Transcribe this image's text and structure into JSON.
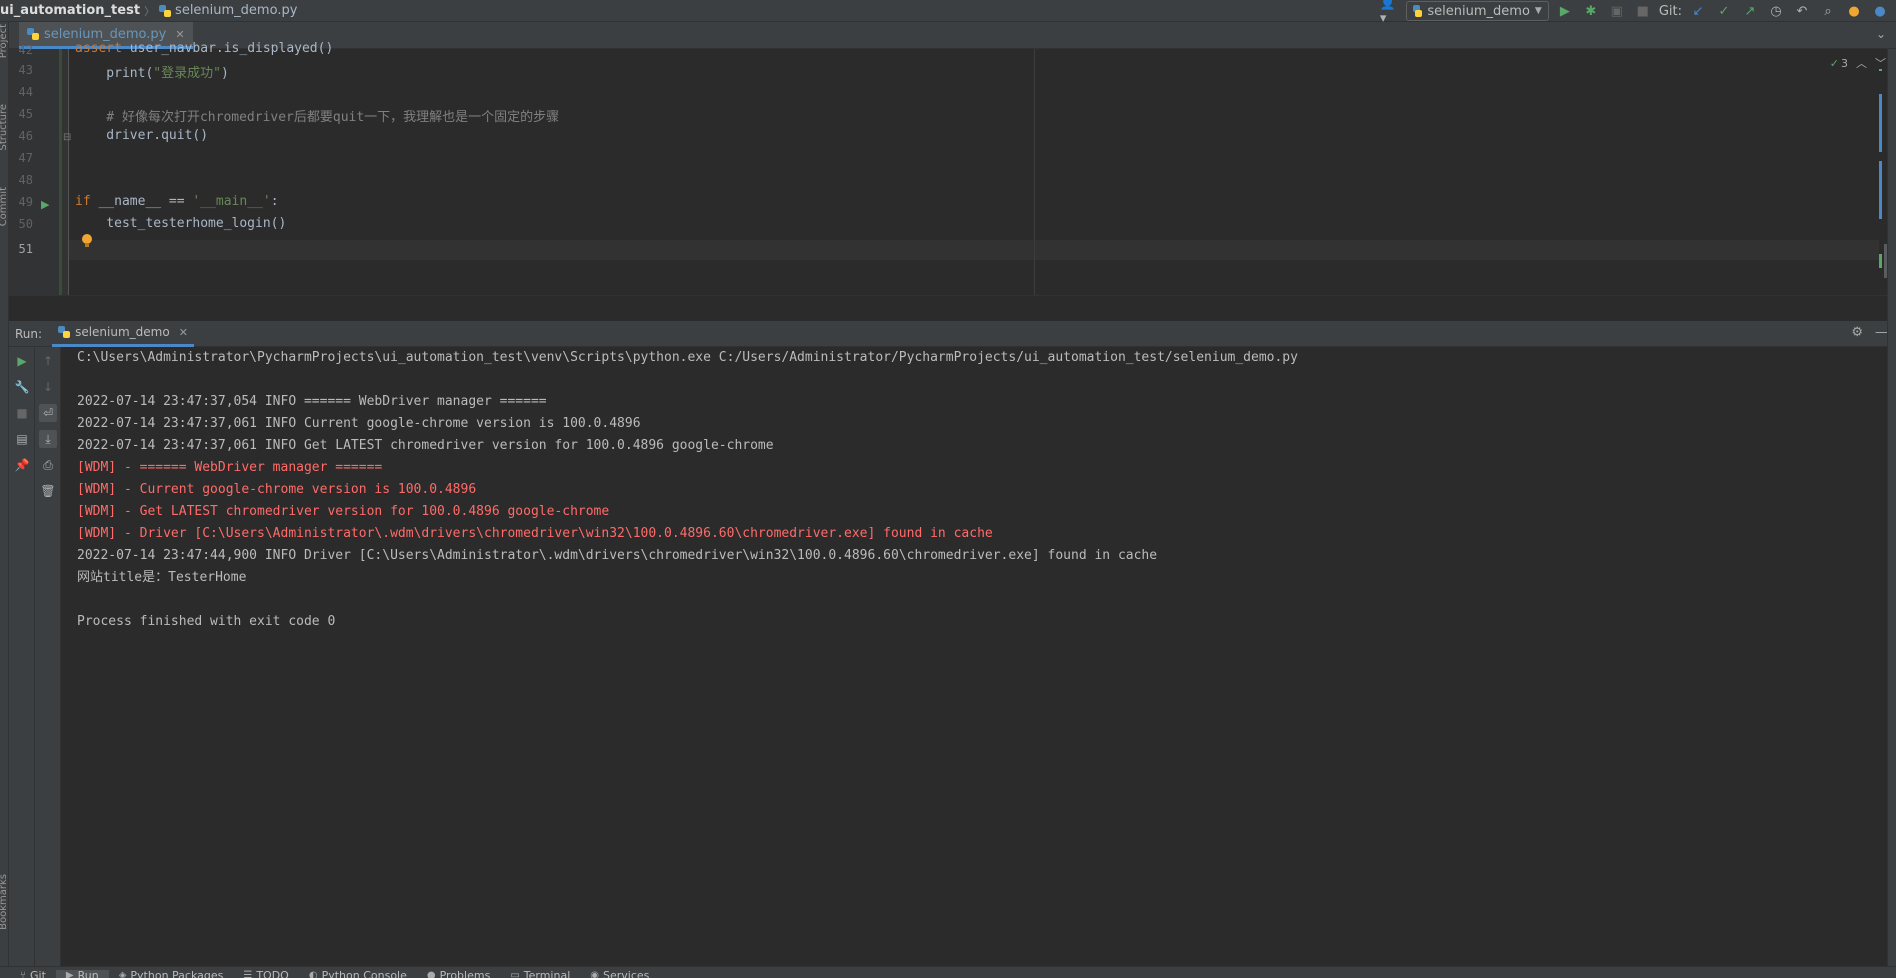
{
  "navbar": {
    "project": "ui_automation_test",
    "file": "selenium_demo.py"
  },
  "toolbar": {
    "run_config": "selenium_demo",
    "git_label": "Git:"
  },
  "editor": {
    "tab_label": "selenium_demo.py",
    "inspection_count": "3",
    "lines": [
      {
        "no": "42",
        "code": "    assert user_navbar.is_displayed()"
      },
      {
        "no": "43",
        "pre": "    print(",
        "str": "\"登录成功\"",
        "post": ")"
      },
      {
        "no": "44",
        "code": ""
      },
      {
        "no": "45",
        "cmt": "    # 好像每次打开chromedriver后都要quit一下，我理解也是一个固定的步骤"
      },
      {
        "no": "46",
        "code": "    driver.quit()"
      },
      {
        "no": "47",
        "code": ""
      },
      {
        "no": "48",
        "code": ""
      },
      {
        "no": "49",
        "kw": "if",
        "mid": " __name__ == ",
        "str": "'__main__'",
        "post": ":"
      },
      {
        "no": "50",
        "code": "    test_testerhome_login()"
      },
      {
        "no": "51",
        "code": ""
      }
    ]
  },
  "run": {
    "label": "Run:",
    "tab": "selenium_demo",
    "console": [
      {
        "text": "C:\\Users\\Administrator\\PycharmProjects\\ui_automation_test\\venv\\Scripts\\python.exe C:/Users/Administrator/PycharmProjects/ui_automation_test/selenium_demo.py",
        "type": "normal"
      },
      {
        "text": "",
        "type": "normal"
      },
      {
        "text": "2022-07-14 23:47:37,054 INFO ====== WebDriver manager ======",
        "type": "normal"
      },
      {
        "text": "2022-07-14 23:47:37,061 INFO Current google-chrome version is 100.0.4896",
        "type": "normal"
      },
      {
        "text": "2022-07-14 23:47:37,061 INFO Get LATEST chromedriver version for 100.0.4896 google-chrome",
        "type": "normal"
      },
      {
        "text": "[WDM] - ====== WebDriver manager ======",
        "type": "err"
      },
      {
        "text": "[WDM] - Current google-chrome version is 100.0.4896",
        "type": "err"
      },
      {
        "text": "[WDM] - Get LATEST chromedriver version for 100.0.4896 google-chrome",
        "type": "err"
      },
      {
        "text": "[WDM] - Driver [C:\\Users\\Administrator\\.wdm\\drivers\\chromedriver\\win32\\100.0.4896.60\\chromedriver.exe] found in cache",
        "type": "err"
      },
      {
        "text": "2022-07-14 23:47:44,900 INFO Driver [C:\\Users\\Administrator\\.wdm\\drivers\\chromedriver\\win32\\100.0.4896.60\\chromedriver.exe] found in cache",
        "type": "normal"
      },
      {
        "text": "网站title是：TesterHome",
        "type": "normal"
      },
      {
        "text": "",
        "type": "normal"
      },
      {
        "text": "Process finished with exit code 0",
        "type": "normal"
      }
    ]
  },
  "left_strip": {
    "project": "Project",
    "structure": "Structure",
    "commit": "Commit",
    "bookmarks": "Bookmarks"
  },
  "bottom_bar": [
    {
      "label": "Git",
      "icon": "git-icon"
    },
    {
      "label": "Run",
      "icon": "run-icon"
    },
    {
      "label": "Python Packages",
      "icon": "packages-icon"
    },
    {
      "label": "TODO",
      "icon": "todo-icon"
    },
    {
      "label": "Python Console",
      "icon": "console-icon"
    },
    {
      "label": "Problems",
      "icon": "problems-icon"
    },
    {
      "label": "Terminal",
      "icon": "terminal-icon"
    },
    {
      "label": "Services",
      "icon": "services-icon"
    }
  ],
  "colors": {
    "background": "#2b2b2b",
    "panel": "#3c3f41",
    "accent": "#4a88c7",
    "error_text": "#ff6b68",
    "keyword": "#cc7832",
    "string": "#6a8759",
    "run_green": "#59a869"
  }
}
